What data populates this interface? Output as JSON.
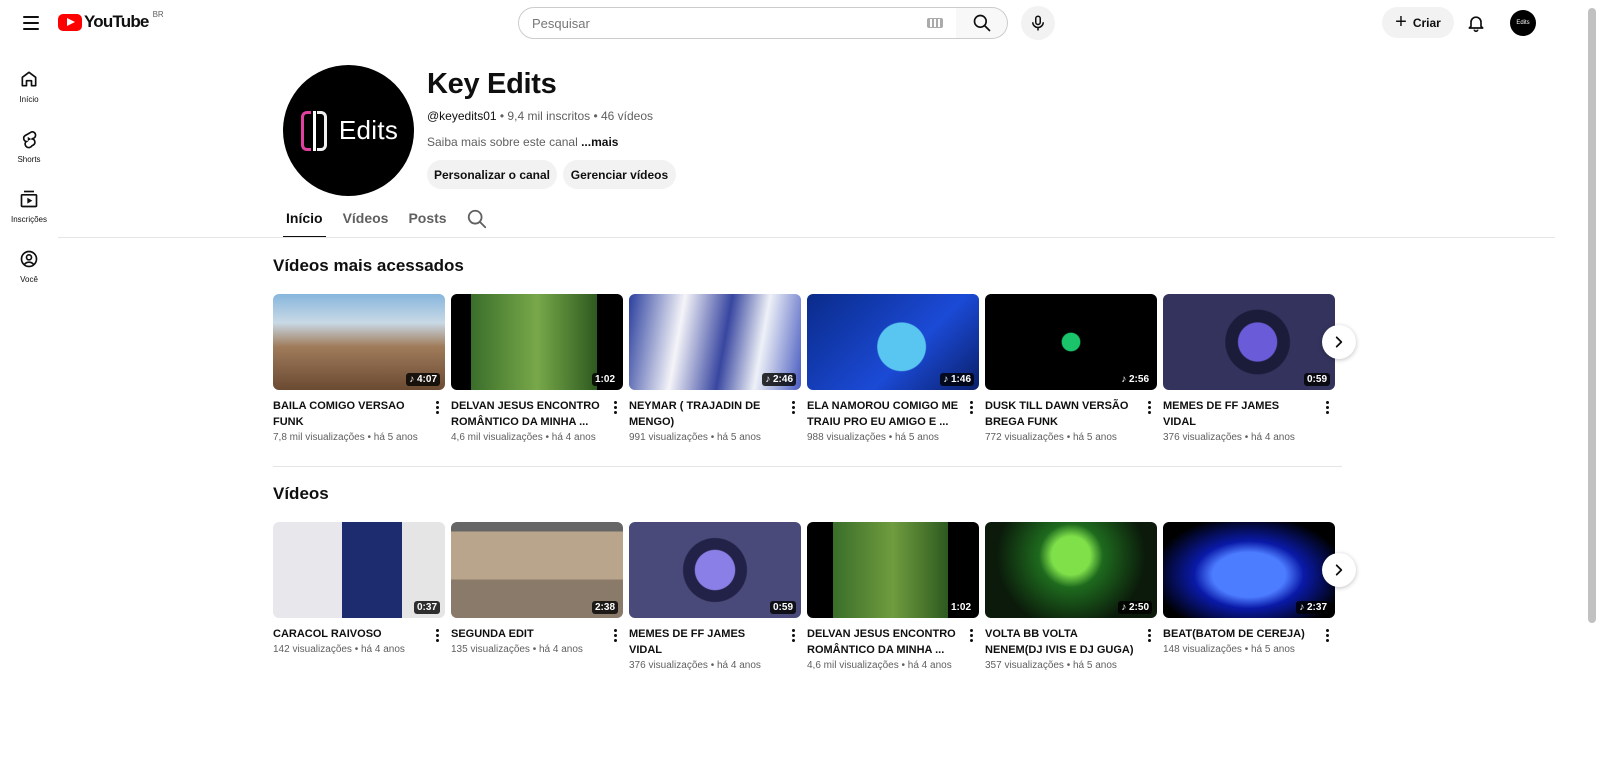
{
  "header": {
    "logo_text": "YouTube",
    "country_code": "BR",
    "search_placeholder": "Pesquisar",
    "create_label": "Criar",
    "avatar_text": "Edits"
  },
  "sidebar": {
    "items": [
      {
        "label": "Início",
        "icon": "home-icon"
      },
      {
        "label": "Shorts",
        "icon": "shorts-icon"
      },
      {
        "label": "Inscrições",
        "icon": "subscriptions-icon"
      },
      {
        "label": "Você",
        "icon": "you-icon"
      }
    ]
  },
  "channel": {
    "avatar_text": "Edits",
    "name": "Key Edits",
    "handle": "@keyedits01",
    "meta_rest": " • 9,4 mil inscritos • 46 vídeos",
    "desc": "Saiba mais sobre este canal ",
    "more": "...mais",
    "customize_label": "Personalizar o canal",
    "manage_label": "Gerenciar vídeos"
  },
  "tabs": [
    {
      "label": "Início",
      "active": true
    },
    {
      "label": "Vídeos",
      "active": false
    },
    {
      "label": "Posts",
      "active": false
    }
  ],
  "sections": [
    {
      "title": "Vídeos mais acessados",
      "videos": [
        {
          "title": "BAILA COMIGO VERSAO FUNK",
          "meta": "7,8 mil visualizações • há 5 anos",
          "duration": "4:07",
          "music": true
        },
        {
          "title": "DELVAN JESUS ENCONTRO ROMÂNTICO DA MINHA ...",
          "meta": "4,6 mil visualizações • há 4 anos",
          "duration": "1:02",
          "music": false
        },
        {
          "title": "NEYMAR ( TRAJADIN DE MENGO)",
          "meta": "991 visualizações • há 5 anos",
          "duration": "2:46",
          "music": true
        },
        {
          "title": "ELA NAMOROU COMIGO ME TRAIU PRO EU AMIGO E ...",
          "meta": "988 visualizações • há 5 anos",
          "duration": "1:46",
          "music": true
        },
        {
          "title": "DUSK TILL DAWN VERSÃO BREGA FUNK",
          "meta": "772 visualizações • há 5 anos",
          "duration": "2:56",
          "music": true
        },
        {
          "title": "MEMES DE FF JAMES VIDAL",
          "meta": "376 visualizações • há 4 anos",
          "duration": "0:59",
          "music": false
        }
      ]
    },
    {
      "title": "Vídeos",
      "videos": [
        {
          "title": "CARACOL RAIVOSO",
          "meta": "142 visualizações • há 4 anos",
          "duration": "0:37",
          "music": false
        },
        {
          "title": "SEGUNDA EDIT",
          "meta": "135 visualizações • há 4 anos",
          "duration": "2:38",
          "music": false
        },
        {
          "title": "MEMES DE FF JAMES VIDAL",
          "meta": "376 visualizações • há 4 anos",
          "duration": "0:59",
          "music": false
        },
        {
          "title": "DELVAN JESUS ENCONTRO ROMÂNTICO DA MINHA ...",
          "meta": "4,6 mil visualizações • há 4 anos",
          "duration": "1:02",
          "music": false
        },
        {
          "title": "VOLTA BB VOLTA NENEM(DJ IVIS E DJ GUGA)",
          "meta": "357 visualizações • há 5 anos",
          "duration": "2:50",
          "music": true
        },
        {
          "title": "BEAT(BATOM DE CEREJA)",
          "meta": "148 visualizações • há 5 anos",
          "duration": "2:37",
          "music": true
        }
      ]
    }
  ]
}
